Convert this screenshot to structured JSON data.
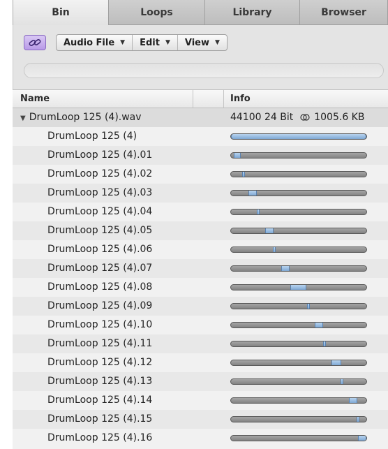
{
  "tabs": [
    {
      "label": "Bin",
      "active": true
    },
    {
      "label": "Loops",
      "active": false
    },
    {
      "label": "Library",
      "active": false
    },
    {
      "label": "Browser",
      "active": false
    }
  ],
  "toolbar": {
    "link_icon": "link-icon",
    "menus": [
      {
        "label": "Audio File"
      },
      {
        "label": "Edit"
      },
      {
        "label": "View"
      }
    ]
  },
  "search": {
    "placeholder": ""
  },
  "columns": {
    "name": "Name",
    "info": "Info"
  },
  "parent": {
    "name": "DrumLoop 125 (4).wav",
    "info_rate": "44100 24 Bit",
    "info_size": "1005.6 KB",
    "stereo_icon": "stereo-link-icon"
  },
  "regions": [
    {
      "name": "DrumLoop 125 (4)",
      "start": 0.0,
      "end": 1.0
    },
    {
      "name": "DrumLoop 125 (4).01",
      "start": 0.02,
      "end": 0.07
    },
    {
      "name": "DrumLoop 125 (4).02",
      "start": 0.08,
      "end": 0.1
    },
    {
      "name": "DrumLoop 125 (4).03",
      "start": 0.13,
      "end": 0.19
    },
    {
      "name": "DrumLoop 125 (4).04",
      "start": 0.19,
      "end": 0.21
    },
    {
      "name": "DrumLoop 125 (4).05",
      "start": 0.25,
      "end": 0.31
    },
    {
      "name": "DrumLoop 125 (4).06",
      "start": 0.31,
      "end": 0.33
    },
    {
      "name": "DrumLoop 125 (4).07",
      "start": 0.37,
      "end": 0.43
    },
    {
      "name": "DrumLoop 125 (4).08",
      "start": 0.44,
      "end": 0.56
    },
    {
      "name": "DrumLoop 125 (4).09",
      "start": 0.56,
      "end": 0.58
    },
    {
      "name": "DrumLoop 125 (4).10",
      "start": 0.62,
      "end": 0.68
    },
    {
      "name": "DrumLoop 125 (4).11",
      "start": 0.68,
      "end": 0.7
    },
    {
      "name": "DrumLoop 125 (4).12",
      "start": 0.74,
      "end": 0.81
    },
    {
      "name": "DrumLoop 125 (4).13",
      "start": 0.81,
      "end": 0.83
    },
    {
      "name": "DrumLoop 125 (4).14",
      "start": 0.87,
      "end": 0.93
    },
    {
      "name": "DrumLoop 125 (4).15",
      "start": 0.93,
      "end": 0.95
    },
    {
      "name": "DrumLoop 125 (4).16",
      "start": 0.94,
      "end": 1.0
    }
  ],
  "colors": {
    "accent": "#b99ae8",
    "region": "#8fb3dd"
  }
}
